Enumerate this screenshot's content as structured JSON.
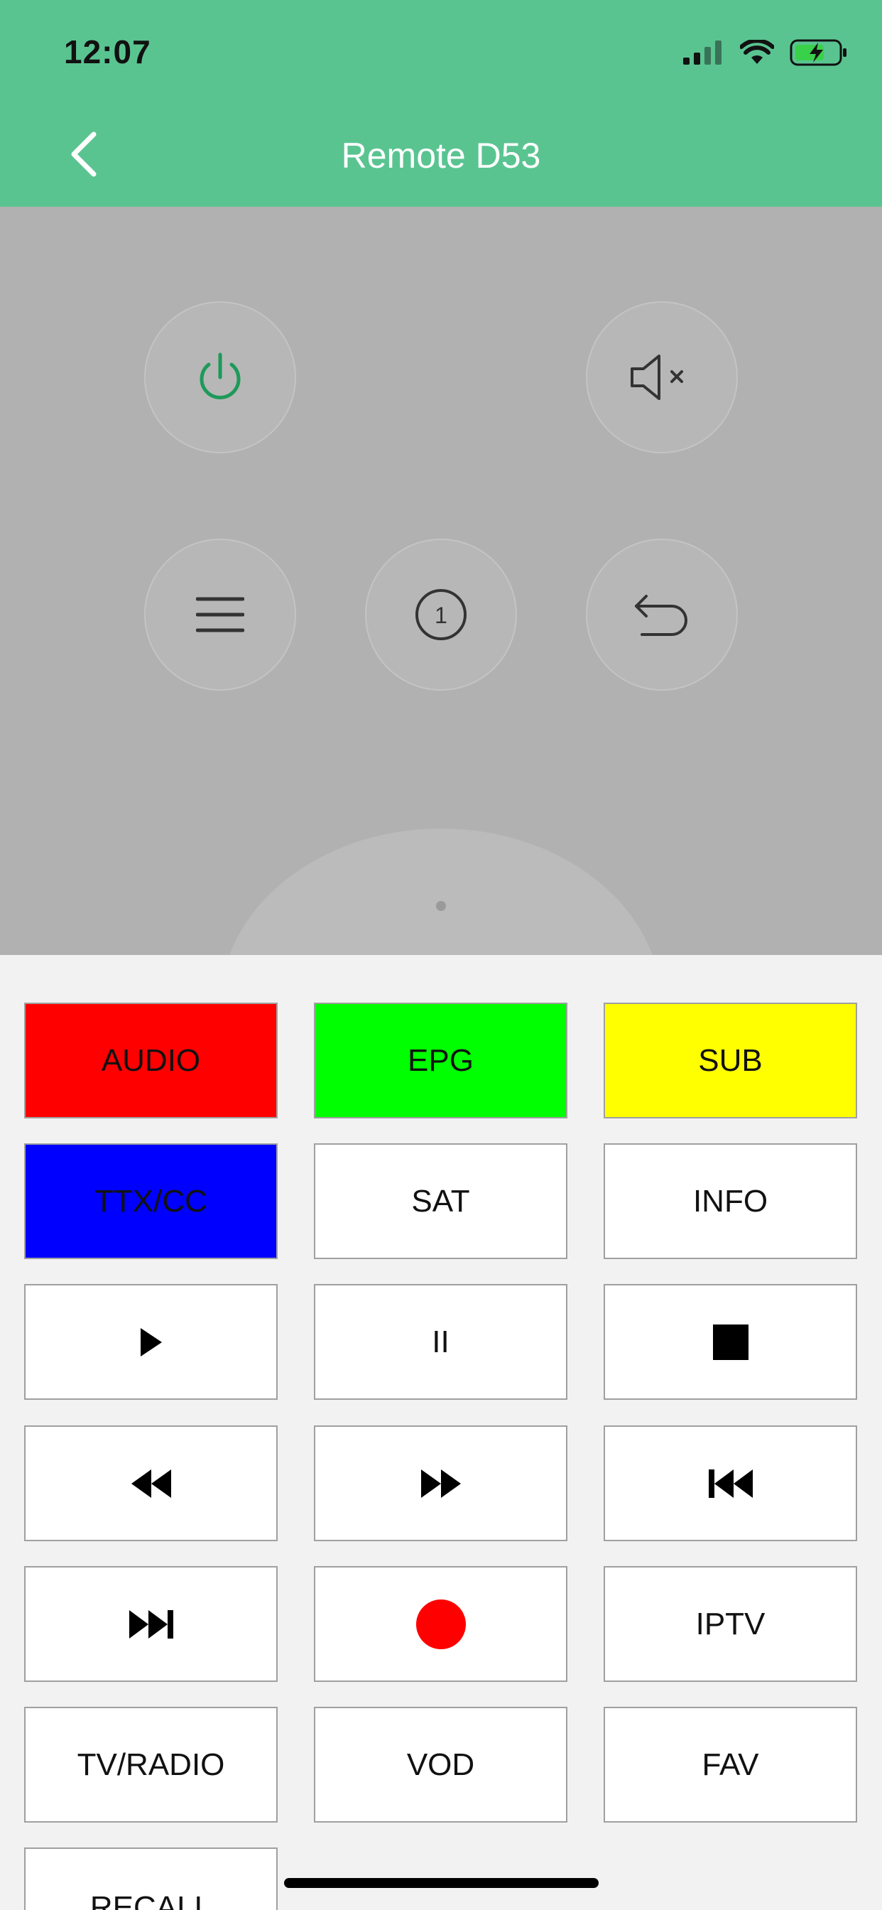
{
  "status_bar": {
    "time": "12:07"
  },
  "header": {
    "title": "Remote D53",
    "back_icon": "chevron-left-icon"
  },
  "remote": {
    "buttons": [
      {
        "name": "power-button",
        "icon": "power-icon"
      },
      {
        "name": "mute-button",
        "icon": "mute-icon"
      },
      {
        "name": "menu-button",
        "icon": "menu-icon"
      },
      {
        "name": "one-button",
        "icon": "circle-one-icon",
        "label": "1"
      },
      {
        "name": "return-button",
        "icon": "return-arrow-icon"
      }
    ]
  },
  "keys": {
    "audio": "AUDIO",
    "epg": "EPG",
    "sub": "SUB",
    "ttx": "TTX/CC",
    "sat": "SAT",
    "info": "INFO",
    "pause": "II",
    "iptv": "IPTV",
    "tv_radio": "TV/RADIO",
    "vod": "VOD",
    "fav": "FAV",
    "recall": "RECALL"
  },
  "colors": {
    "header_green": "#5ac491",
    "audio_red": "#ff0000",
    "epg_green": "#00ff00",
    "sub_yellow": "#ffff00",
    "ttx_blue": "#0000ff",
    "power_icon": "#1d9a5a",
    "record_red": "#ff0000"
  }
}
